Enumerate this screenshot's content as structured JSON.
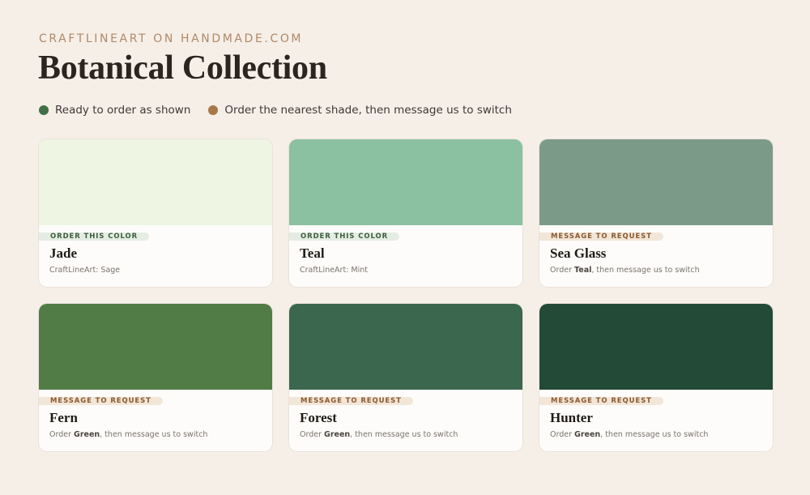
{
  "header": {
    "eyebrow": "CRAFTLINEART ON HANDMADE.COM",
    "title": "Botanical Collection"
  },
  "legend": [
    {
      "label": "Ready to order as shown",
      "color": "#3f7046"
    },
    {
      "label": "Order the nearest shade, then message us to switch",
      "color": "#a6784a"
    }
  ],
  "cards": [
    {
      "name": "Jade",
      "swatch_color": "#eef6e3",
      "badge": "ORDER THIS COLOR",
      "badge_type": "order",
      "sub_prefix": "CraftLineArt: Sage",
      "sub_bold": "",
      "sub_suffix": ""
    },
    {
      "name": "Teal",
      "swatch_color": "#8bc1a0",
      "badge": "ORDER THIS COLOR",
      "badge_type": "order",
      "sub_prefix": "CraftLineArt: Mint",
      "sub_bold": "",
      "sub_suffix": ""
    },
    {
      "name": "Sea Glass",
      "swatch_color": "#7c9a88",
      "badge": "MESSAGE TO REQUEST",
      "badge_type": "message",
      "sub_prefix": "Order ",
      "sub_bold": "Teal",
      "sub_suffix": ", then message us to switch"
    },
    {
      "name": "Fern",
      "swatch_color": "#527c46",
      "badge": "MESSAGE TO REQUEST",
      "badge_type": "message",
      "sub_prefix": "Order ",
      "sub_bold": "Green",
      "sub_suffix": ", then message us to switch"
    },
    {
      "name": "Forest",
      "swatch_color": "#3a674e",
      "badge": "MESSAGE TO REQUEST",
      "badge_type": "message",
      "sub_prefix": "Order ",
      "sub_bold": "Green",
      "sub_suffix": ", then message us to switch"
    },
    {
      "name": "Hunter",
      "swatch_color": "#224a36",
      "badge": "MESSAGE TO REQUEST",
      "badge_type": "message",
      "sub_prefix": "Order ",
      "sub_bold": "Green",
      "sub_suffix": ", then message us to switch"
    }
  ]
}
